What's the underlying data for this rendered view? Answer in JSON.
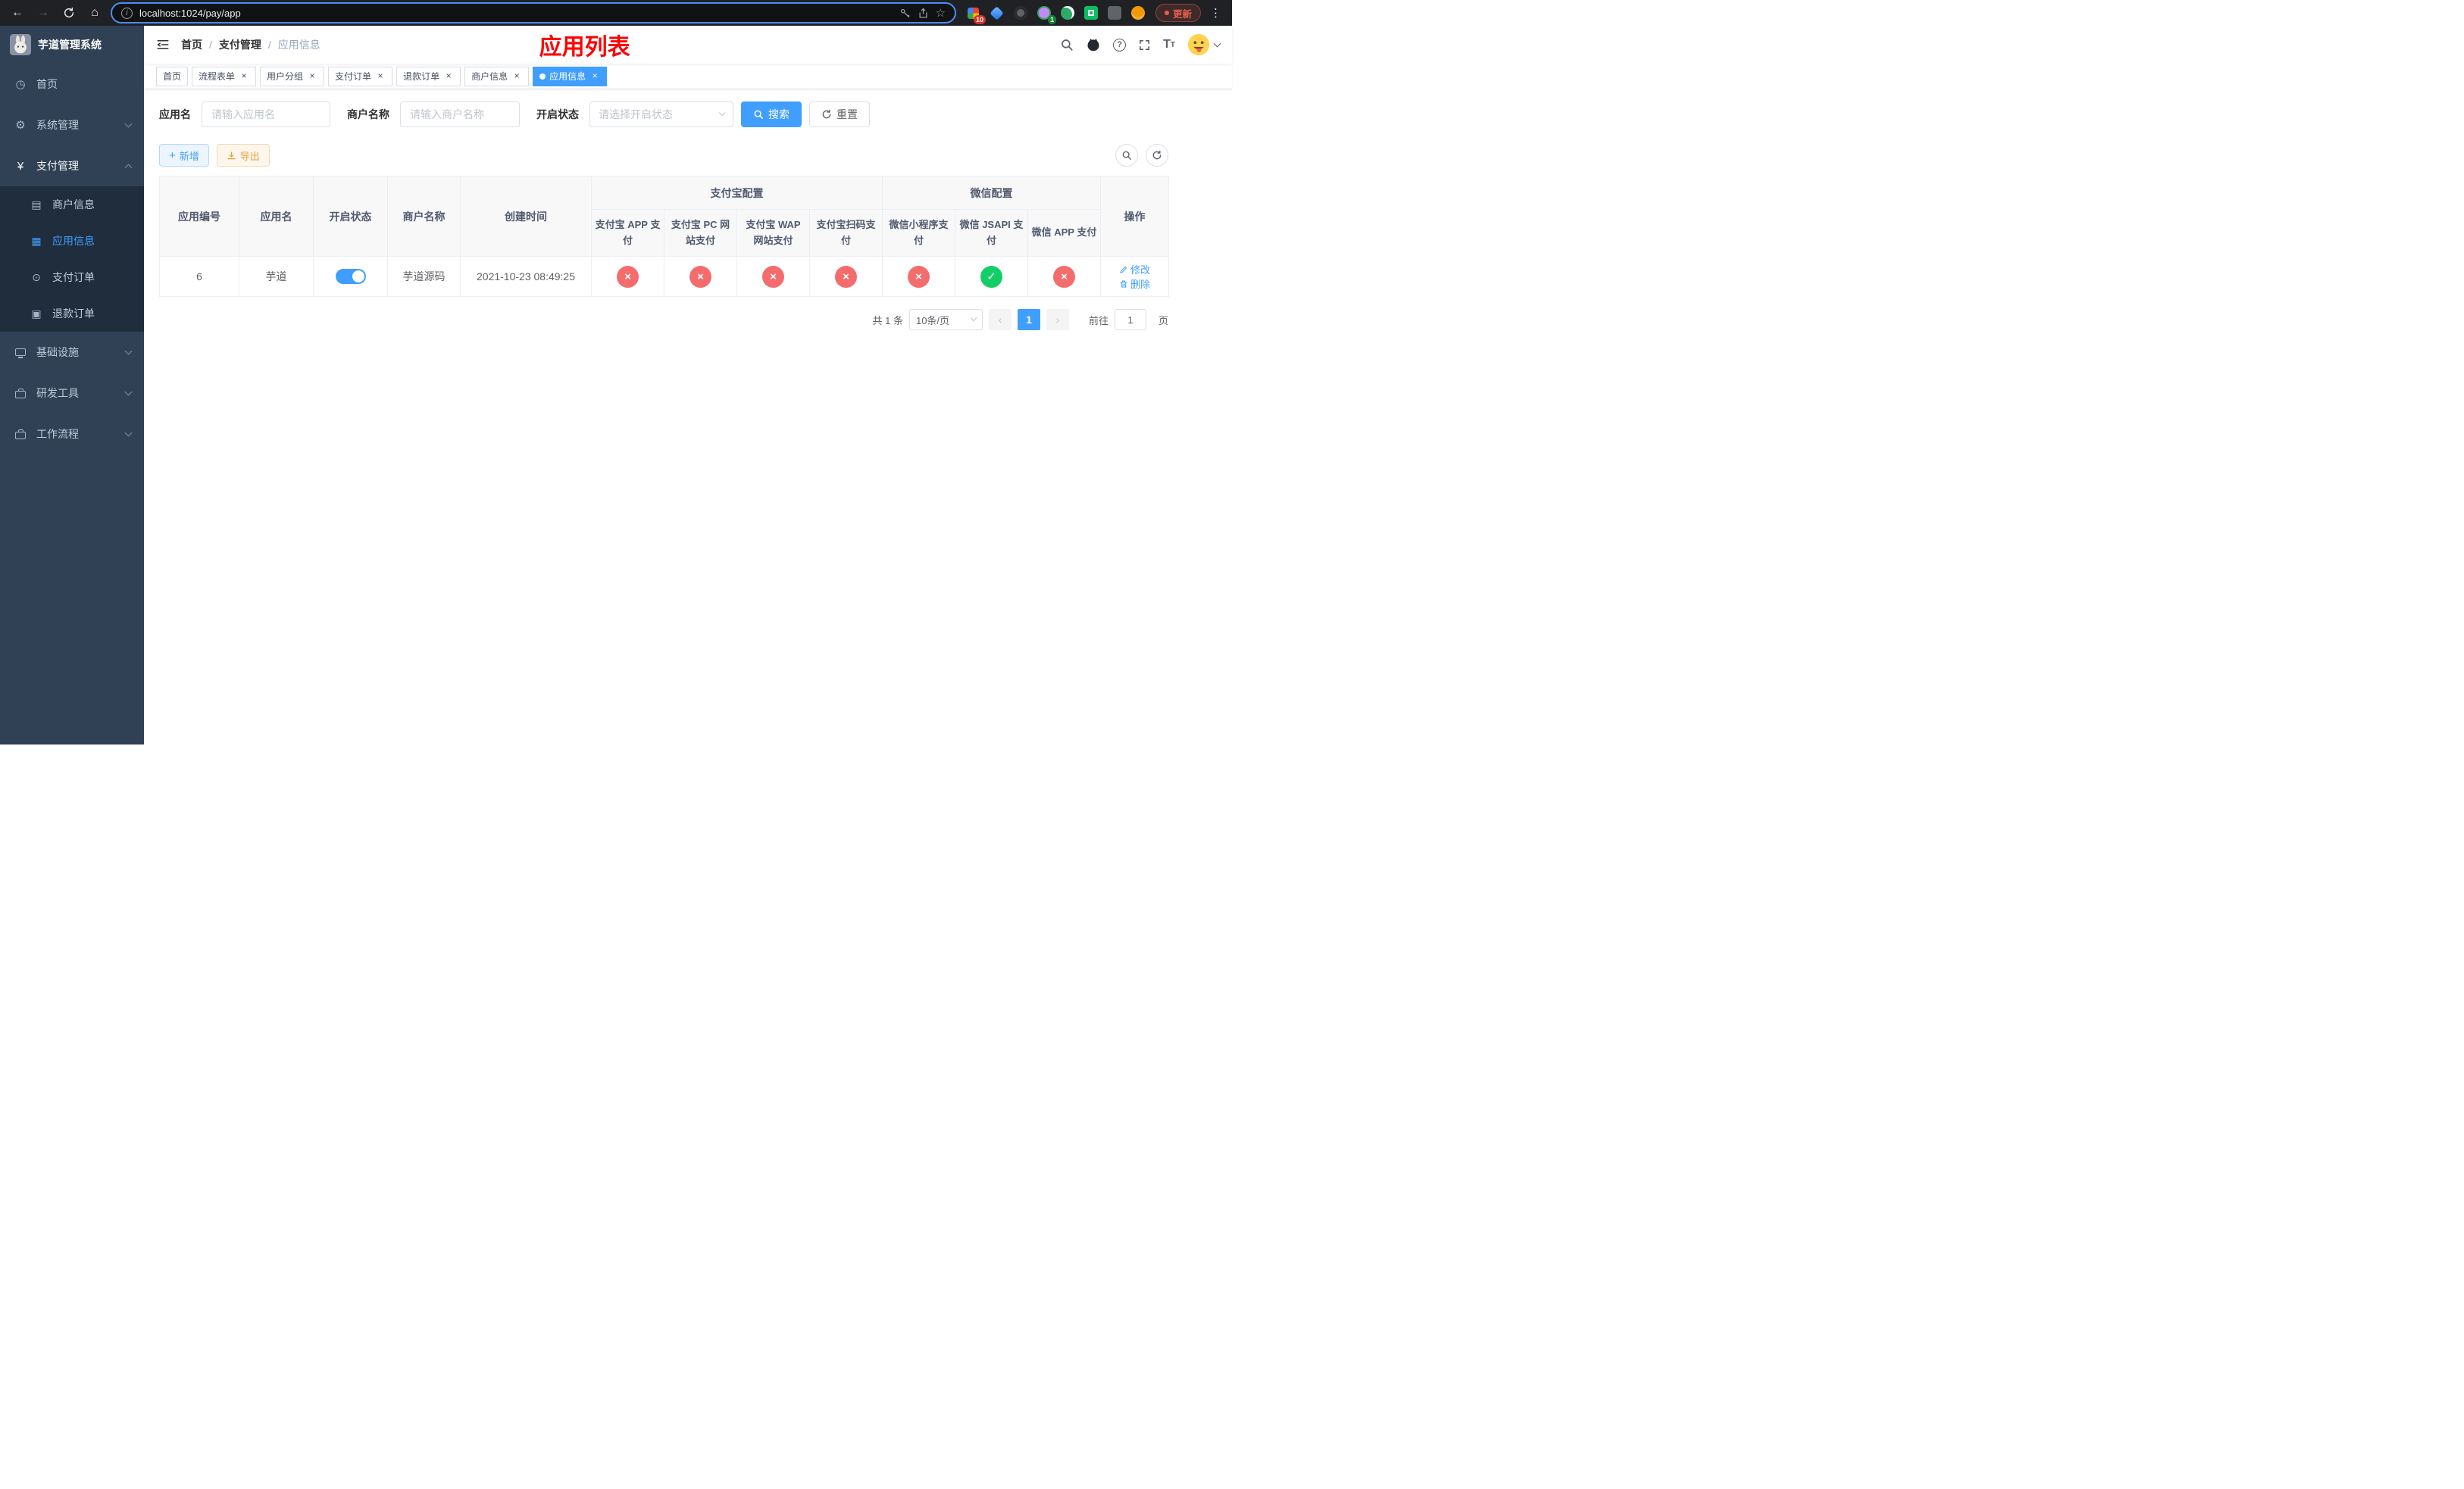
{
  "colors": {
    "primary": "#409eff",
    "success": "#13ce66",
    "danger": "#f56c6c",
    "warning": "#e6a23c",
    "banner_red": "#fe0000",
    "sidebar_bg": "#304156",
    "submenu_bg": "#1f2d3d"
  },
  "browser": {
    "url": "localhost:1024/pay/app",
    "update_label": "更新",
    "extension_badges": {
      "apps": "10",
      "profile": "1"
    }
  },
  "icons": {
    "back": "←",
    "forward": "→",
    "home": "⌂",
    "star": "☆",
    "kebab": "⋮",
    "info": "i",
    "close": "×",
    "plus": "+",
    "check": "✓",
    "cross": "×",
    "dashboard": "◷",
    "gear": "⚙",
    "yen": "¥",
    "card": "▤",
    "grid": "▦",
    "order": "⊙",
    "refund": "▣",
    "prev": "‹",
    "next": "›",
    "help": "?",
    "font_size": "T"
  },
  "sidebar": {
    "title": "芋道管理系统",
    "items": [
      {
        "label": "首页"
      },
      {
        "label": "系统管理",
        "expandable": true
      },
      {
        "label": "支付管理",
        "expandable": true,
        "expanded": true,
        "children": [
          {
            "label": "商户信息"
          },
          {
            "label": "应用信息",
            "active": true
          },
          {
            "label": "支付订单"
          },
          {
            "label": "退款订单"
          }
        ]
      },
      {
        "label": "基础设施",
        "expandable": true
      },
      {
        "label": "研发工具",
        "expandable": true
      },
      {
        "label": "工作流程",
        "expandable": true
      }
    ]
  },
  "header": {
    "breadcrumb": [
      "首页",
      "支付管理",
      "应用信息"
    ],
    "banner": "应用列表"
  },
  "tabs": [
    {
      "label": "首页",
      "closable": false,
      "active": false
    },
    {
      "label": "流程表单",
      "closable": true,
      "active": false
    },
    {
      "label": "用户分组",
      "closable": true,
      "active": false
    },
    {
      "label": "支付订单",
      "closable": true,
      "active": false
    },
    {
      "label": "退款订单",
      "closable": true,
      "active": false
    },
    {
      "label": "商户信息",
      "closable": true,
      "active": false
    },
    {
      "label": "应用信息",
      "closable": true,
      "active": true
    }
  ],
  "filters": {
    "fields": [
      {
        "label": "应用名",
        "placeholder": "请输入应用名",
        "type": "input"
      },
      {
        "label": "商户名称",
        "placeholder": "请输入商户名称",
        "type": "input"
      },
      {
        "label": "开启状态",
        "placeholder": "请选择开启状态",
        "type": "select"
      }
    ],
    "search_label": "搜索",
    "reset_label": "重置"
  },
  "toolbar": {
    "add_label": "新增",
    "export_label": "导出"
  },
  "table": {
    "fixed_columns": [
      "应用编号",
      "应用名",
      "开启状态",
      "商户名称",
      "创建时间"
    ],
    "alipay_group": "支付宝配置",
    "alipay_columns": [
      "支付宝 APP 支付",
      "支付宝 PC 网站支付",
      "支付宝 WAP 网站支付",
      "支付宝扫码支付"
    ],
    "wechat_group": "微信配置",
    "wechat_columns": [
      "微信小程序支付",
      "微信 JSAPI 支付",
      "微信 APP 支付"
    ],
    "actions_column": "操作",
    "rows": [
      {
        "id": "6",
        "name": "芋道",
        "enabled": true,
        "merchant": "芋道源码",
        "created": "2021-10-23 08:49:25",
        "statuses": [
          "fail",
          "fail",
          "fail",
          "fail",
          "fail",
          "success",
          "fail"
        ],
        "edit_label": "修改",
        "delete_label": "删除"
      }
    ]
  },
  "pagination": {
    "total_label": "共 1 条",
    "page_size_label": "10条/页",
    "current_page": "1",
    "goto_label": "前往",
    "goto_value": "1",
    "page_unit_label": "页"
  }
}
